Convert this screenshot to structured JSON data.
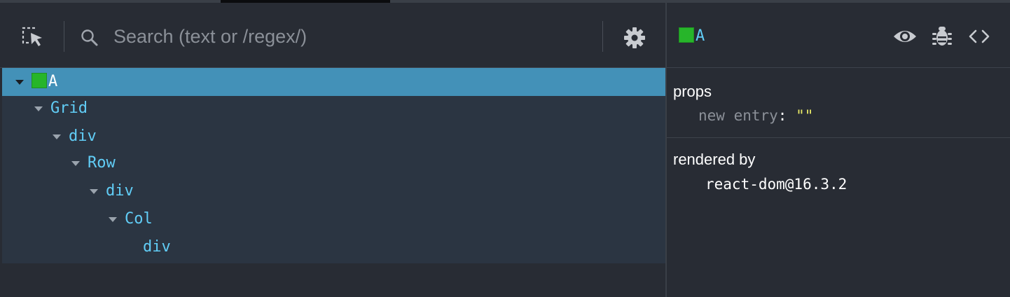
{
  "toolbar": {
    "select_tool_icon": "select-element-icon",
    "search": {
      "placeholder": "Search (text or /regex/)",
      "value": "",
      "icon": "search-icon"
    },
    "settings_icon": "gear-icon"
  },
  "tree": {
    "rows": [
      {
        "label": "A",
        "depth": 0,
        "expanded": true,
        "selected": true,
        "badge_color": "#27b52a"
      },
      {
        "label": "Grid",
        "depth": 1,
        "expanded": true
      },
      {
        "label": "div",
        "depth": 2,
        "expanded": true
      },
      {
        "label": "Row",
        "depth": 3,
        "expanded": true
      },
      {
        "label": "div",
        "depth": 4,
        "expanded": true
      },
      {
        "label": "Col",
        "depth": 5,
        "expanded": true
      },
      {
        "label": "div",
        "depth": 6,
        "expanded": false
      }
    ]
  },
  "inspector": {
    "title": "A",
    "title_badge_color": "#27b52a",
    "actions": {
      "inspect_icon": "eye-icon",
      "log_icon": "bug-icon",
      "source_icon": "code-brackets-icon"
    },
    "props": {
      "title": "props",
      "entry_key": "new entry",
      "entry_colon": ":",
      "entry_value": "\"\""
    },
    "rendered_by": {
      "title": "rendered by",
      "owner": "react-dom@16.3.2"
    }
  },
  "colors": {
    "background": "#282c34",
    "tree_background": "#2b3542",
    "selected_row": "#4391b8",
    "component_name": "#61cdf6",
    "string_value": "#ecec67"
  }
}
